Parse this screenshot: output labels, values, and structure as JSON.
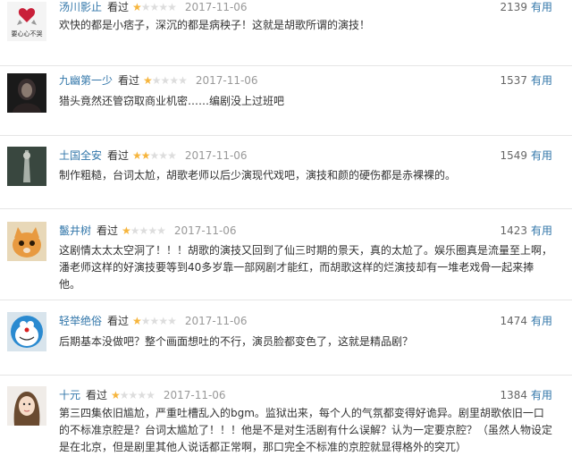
{
  "reviews": [
    {
      "username": "汤川影止",
      "status": "看过",
      "rating": 1,
      "date": "2017-11-06",
      "votes": "2139",
      "useful_label": "有用",
      "avatar_text": "要心心不哭",
      "text": "欢快的都是小痞子，深沉的都是病秧子！这就是胡歌所谓的演技！"
    },
    {
      "username": "九幽第一少",
      "status": "看过",
      "rating": 1,
      "date": "2017-11-06",
      "votes": "1537",
      "useful_label": "有用",
      "text": "猎头竟然还管窃取商业机密……编剧没上过班吧"
    },
    {
      "username": "土国全安",
      "status": "看过",
      "rating": 2,
      "date": "2017-11-06",
      "votes": "1549",
      "useful_label": "有用",
      "text": "制作粗糙，台词太尬，胡歌老师以后少演现代戏吧，演技和颜的硬伤都是赤裸裸的。"
    },
    {
      "username": "鬣井树",
      "status": "看过",
      "rating": 1,
      "date": "2017-11-06",
      "votes": "1423",
      "useful_label": "有用",
      "text": "这剧情太太太空洞了！！！胡歌的演技又回到了仙三时期的景天，真的太尬了。娱乐圈真是流量至上啊，潘老师这样的好演技要等到40多岁靠一部网剧才能红，而胡歌这样的烂演技却有一堆老戏骨一起来捧他。"
    },
    {
      "username": "轻举绝俗",
      "status": "看过",
      "rating": 1,
      "date": "2017-11-06",
      "votes": "1474",
      "useful_label": "有用",
      "text": "后期基本没做吧？整个画面想吐的不行，演员脸都变色了，这就是精品剧？"
    },
    {
      "username": "十元",
      "status": "看过",
      "rating": 1,
      "date": "2017-11-06",
      "votes": "1384",
      "useful_label": "有用",
      "text": "第三四集依旧尴尬，严重吐槽乱入的bgm。监狱出来，每个人的气氛都变得好诡异。剧里胡歌依旧一口的不标准京腔是？台词太尴尬了！！！他是不是对生活剧有什么误解？认为一定要京腔？（虽然人物设定是在北京，但是剧里其他人说话都正常啊，那口完全不标准的京腔就显得格外的突兀）"
    }
  ],
  "colors": {
    "link": "#3377aa",
    "star": "#f6b53d",
    "star_off": "#dddddd",
    "date": "#999999"
  }
}
